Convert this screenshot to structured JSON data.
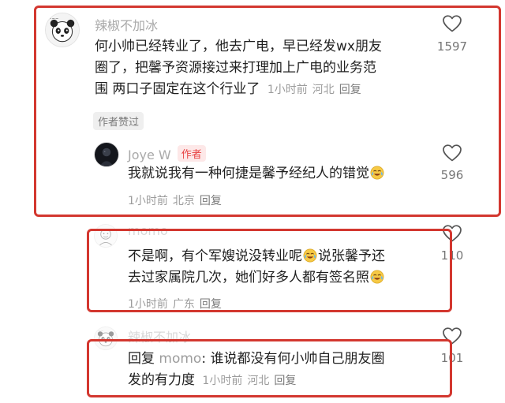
{
  "comments": [
    {
      "username": "辣椒不加冰",
      "line1": "何小帅已经转业了，他去广电，早已经发wx朋友",
      "line2": "圈了，把馨予资源接过来打理加上广电的业务范",
      "line3": "围 两口子固定在这个行业了",
      "time": "1小时前",
      "location": "河北",
      "reply_label": "回复",
      "author_liked": "作者赞过",
      "likes": "1597",
      "icon": "heart-outline-icon"
    },
    {
      "username": "Joye W",
      "author_badge": "作者",
      "line1": "我就说我有一种何捷是馨予经纪人的错觉",
      "time": "1小时前",
      "location": "北京",
      "reply_label": "回复",
      "likes": "596",
      "emoji": "crying-laughing-emoji"
    },
    {
      "username": "momo",
      "line1a": "不是啊，有个军嫂说没转业呢",
      "line1b": "说张馨予还",
      "line2": "去过家属院几次，她们好多人都有签名照",
      "time": "1小时前",
      "location": "广东",
      "reply_label": "回复",
      "likes": "110",
      "emoji": "crying-laughing-emoji"
    },
    {
      "username": "辣椒不加冰",
      "reply_prefix": "回复",
      "reply_target": "momo",
      "line1": ": 谁说都没有何小帅自己朋友圈",
      "line2": "发的有力度",
      "time": "1小时前",
      "location": "河北",
      "reply_label": "回复",
      "likes": "101"
    }
  ],
  "colors": {
    "highlight_box": "#d3372f",
    "author_badge": "#e84545"
  }
}
